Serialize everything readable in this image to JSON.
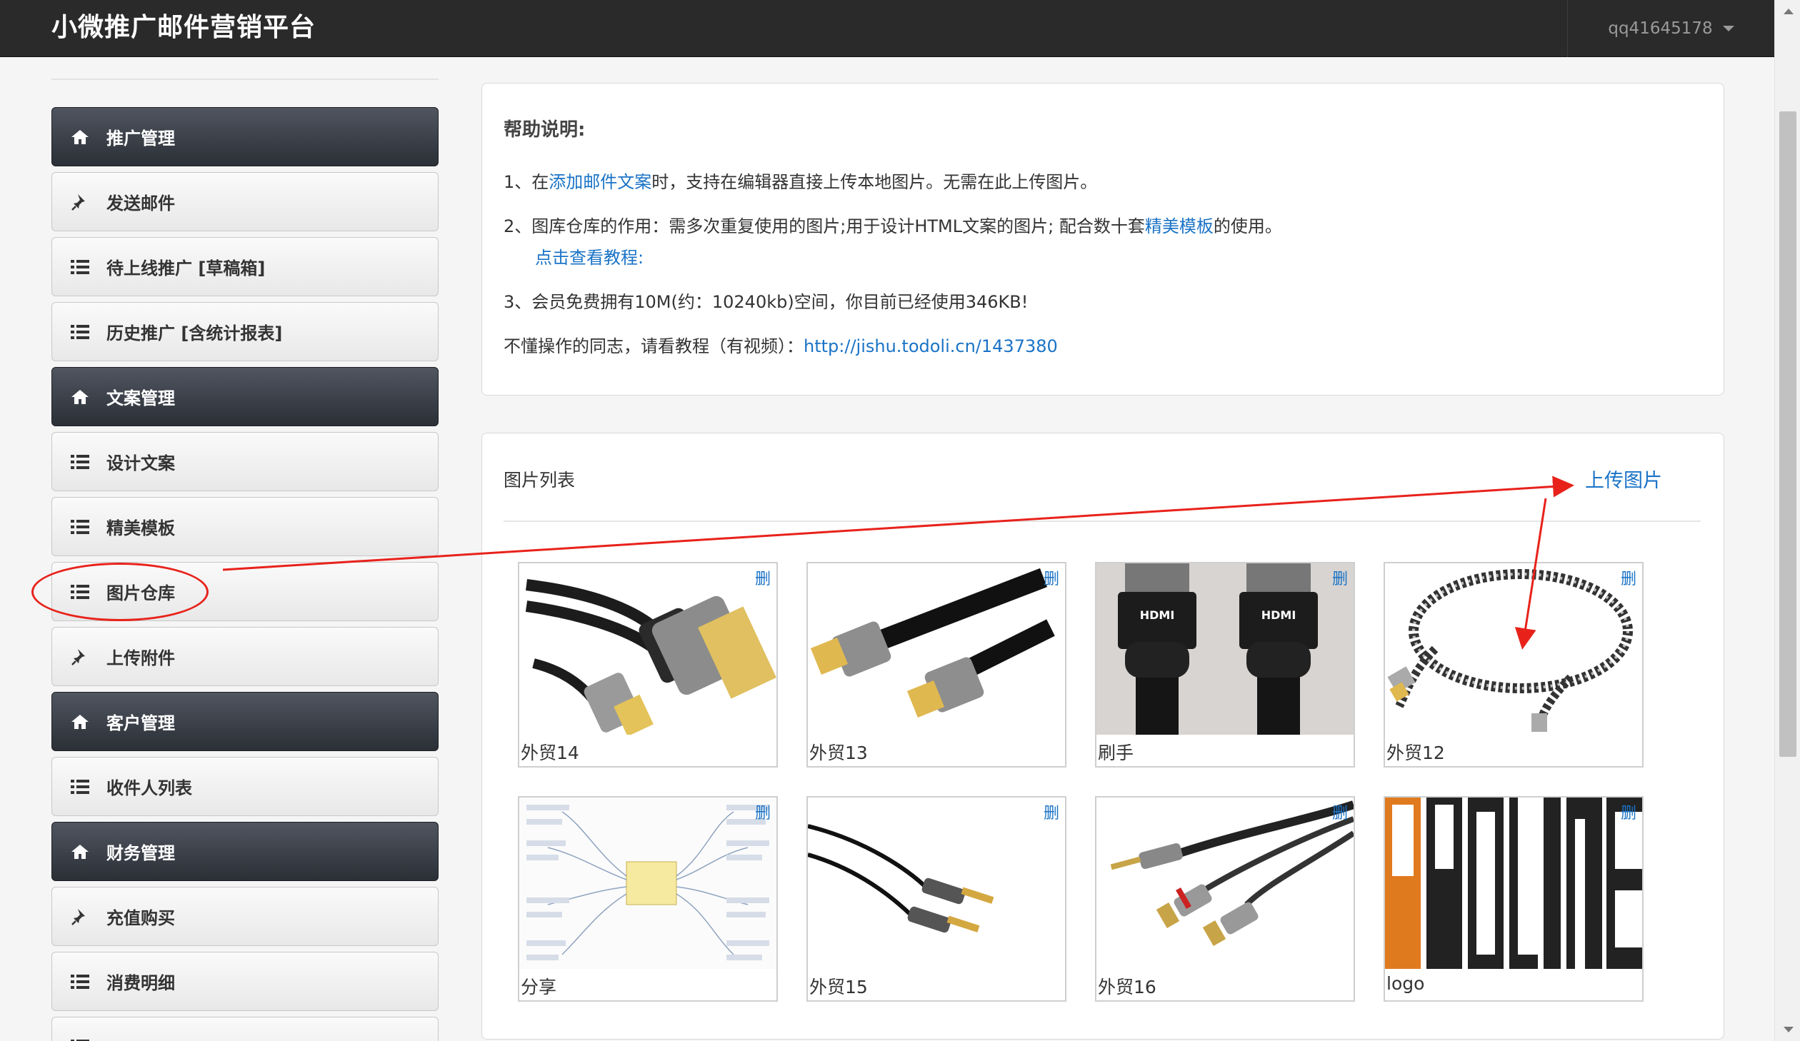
{
  "header": {
    "brand": "小微推广邮件营销平台",
    "username": "qq41645178"
  },
  "sidebar": {
    "items": [
      {
        "label": "推广管理",
        "type": "header",
        "icon": "home-icon"
      },
      {
        "label": "发送邮件",
        "type": "item",
        "icon": "pin-icon"
      },
      {
        "label": "待上线推广 [草稿箱]",
        "type": "item",
        "icon": "list-icon"
      },
      {
        "label": "历史推广 [含统计报表]",
        "type": "item",
        "icon": "list-icon"
      },
      {
        "label": "文案管理",
        "type": "header",
        "icon": "home-icon"
      },
      {
        "label": "设计文案",
        "type": "item",
        "icon": "list-icon"
      },
      {
        "label": "精美模板",
        "type": "item",
        "icon": "list-icon"
      },
      {
        "label": "图片仓库",
        "type": "item",
        "icon": "list-icon"
      },
      {
        "label": "上传附件",
        "type": "item",
        "icon": "pin-icon"
      },
      {
        "label": "客户管理",
        "type": "header",
        "icon": "home-icon"
      },
      {
        "label": "收件人列表",
        "type": "item",
        "icon": "list-icon"
      },
      {
        "label": "财务管理",
        "type": "header",
        "icon": "home-icon"
      },
      {
        "label": "充值购买",
        "type": "item",
        "icon": "pin-icon"
      },
      {
        "label": "消费明细",
        "type": "item",
        "icon": "list-icon"
      },
      {
        "label": "",
        "type": "item",
        "icon": "list-icon"
      }
    ]
  },
  "help": {
    "title": "帮助说明:",
    "line1_prefix": "1、在",
    "line1_link": "添加邮件文案",
    "line1_suffix": "时，支持在编辑器直接上传本地图片。无需在此上传图片。",
    "line2_prefix": "2、图库仓库的作用：需多次重复使用的图片;用于设计HTML文案的图片; 配合数十套",
    "line2_link": "精美模板",
    "line2_suffix": "的使用。",
    "line2_tutorial": "点击查看教程:",
    "line3": "3、会员免费拥有10M(约：10240kb)空间，你目前已经使用346KB!",
    "line4_prefix": "不懂操作的同志，请看教程（有视频）：",
    "line4_link": "http://jishu.todoli.cn/1437380"
  },
  "gallery": {
    "title": "图片列表",
    "upload_label": "上传图片",
    "delete_label": "删",
    "images": [
      {
        "caption": "外贸14",
        "kind": "dvi-cable"
      },
      {
        "caption": "外贸13",
        "kind": "flat-hdmi"
      },
      {
        "caption": "刷手",
        "kind": "hdmi-plugs"
      },
      {
        "caption": "外贸12",
        "kind": "braided-cable"
      },
      {
        "caption": "分享",
        "kind": "mindmap"
      },
      {
        "caption": "外贸15",
        "kind": "audio-cable"
      },
      {
        "caption": "外贸16",
        "kind": "rca-cable"
      },
      {
        "caption": "logo",
        "kind": "proline-logo"
      }
    ]
  },
  "colors": {
    "accent": "#1a73c6",
    "annotation": "#e8221b",
    "topbar": "#2a2a2a"
  }
}
